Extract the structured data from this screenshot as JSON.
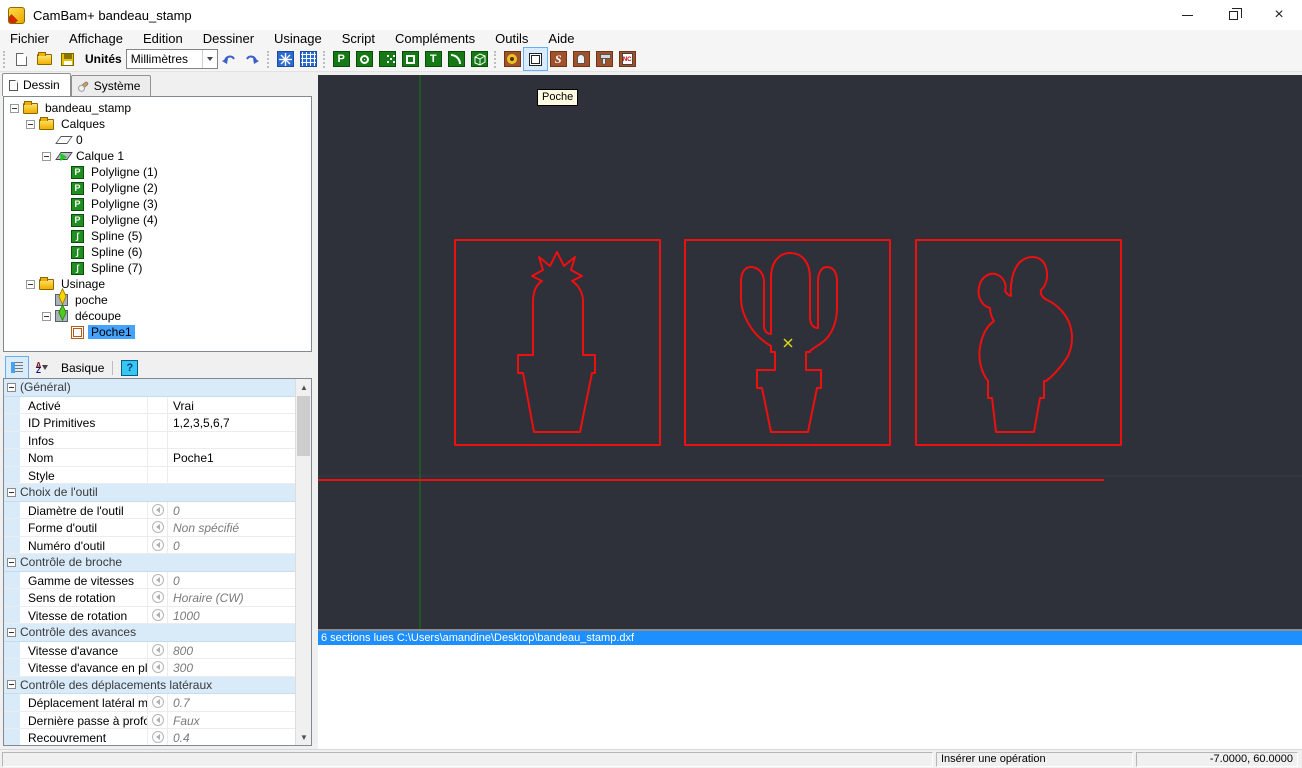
{
  "window": {
    "title": "CamBam+ bandeau_stamp"
  },
  "menu": {
    "items": [
      "Fichier",
      "Affichage",
      "Edition",
      "Dessiner",
      "Usinage",
      "Script",
      "Compléments",
      "Outils",
      "Aide"
    ]
  },
  "toolbar": {
    "units_label": "Unités",
    "units_value": "Millimètres",
    "icons": [
      "new-file",
      "open-file",
      "save",
      "undo",
      "redo",
      "snap-axis",
      "grid",
      "draw-polyline",
      "draw-circle",
      "draw-points",
      "draw-rectangle",
      "draw-text",
      "draw-arc",
      "draw-surface",
      "mach-contour",
      "mach-pocket",
      "mach-engrave",
      "mach-drill",
      "mach-profile3d",
      "mach-gcode"
    ],
    "highlighted_icon": "mach-pocket"
  },
  "tabs": {
    "drawing": "Dessin",
    "system": "Système"
  },
  "tree": {
    "items": [
      {
        "label": "bandeau_stamp",
        "icon": "folder",
        "level": 0,
        "exp": true
      },
      {
        "label": "Calques",
        "icon": "folder",
        "level": 1,
        "exp": true
      },
      {
        "label": "0",
        "icon": "layer",
        "level": 2,
        "exp": false
      },
      {
        "label": "Calque 1",
        "icon": "layer-active",
        "level": 2,
        "exp": true
      },
      {
        "label": "Polyligne (1)",
        "icon": "polyline",
        "level": 3,
        "exp": false
      },
      {
        "label": "Polyligne (2)",
        "icon": "polyline",
        "level": 3,
        "exp": false
      },
      {
        "label": "Polyligne (3)",
        "icon": "polyline",
        "level": 3,
        "exp": false
      },
      {
        "label": "Polyligne (4)",
        "icon": "polyline",
        "level": 3,
        "exp": false
      },
      {
        "label": "Spline (5)",
        "icon": "spline",
        "level": 3,
        "exp": false
      },
      {
        "label": "Spline (6)",
        "icon": "spline",
        "level": 3,
        "exp": false
      },
      {
        "label": "Spline (7)",
        "icon": "spline",
        "level": 3,
        "exp": false
      },
      {
        "label": "Usinage",
        "icon": "folder",
        "level": 1,
        "exp": true
      },
      {
        "label": "poche",
        "icon": "mach-yellow",
        "level": 2,
        "exp": false
      },
      {
        "label": "découpe",
        "icon": "mach-green",
        "level": 2,
        "exp": true
      },
      {
        "label": "Poche1",
        "icon": "pocket-op",
        "level": 3,
        "exp": false,
        "selected": true
      }
    ]
  },
  "properties": {
    "view_label": "Basique",
    "help_label": "?",
    "rows": [
      {
        "type": "cat",
        "label": "(Général)"
      },
      {
        "type": "row",
        "name": "Activé",
        "value": "Vrai",
        "def": false,
        "icon": false
      },
      {
        "type": "row",
        "name": "ID Primitives",
        "value": "1,2,3,5,6,7",
        "def": false,
        "icon": false
      },
      {
        "type": "row",
        "name": "Infos",
        "value": "",
        "def": false,
        "icon": false
      },
      {
        "type": "row",
        "name": "Nom",
        "value": "Poche1",
        "def": false,
        "icon": false
      },
      {
        "type": "row",
        "name": "Style",
        "value": "",
        "def": false,
        "icon": false
      },
      {
        "type": "cat",
        "label": "Choix de l'outil"
      },
      {
        "type": "row",
        "name": "Diamètre de l'outil",
        "value": "0",
        "def": true,
        "icon": true
      },
      {
        "type": "row",
        "name": "Forme d'outil",
        "value": "Non spécifié",
        "def": true,
        "icon": true
      },
      {
        "type": "row",
        "name": "Numéro d'outil",
        "value": "0",
        "def": true,
        "icon": true
      },
      {
        "type": "cat",
        "label": "Contrôle de broche"
      },
      {
        "type": "row",
        "name": "Gamme de vitesses",
        "value": "0",
        "def": true,
        "icon": true
      },
      {
        "type": "row",
        "name": "Sens de rotation",
        "value": "Horaire (CW)",
        "def": true,
        "icon": true
      },
      {
        "type": "row",
        "name": "Vitesse de rotation",
        "value": "1000",
        "def": true,
        "icon": true
      },
      {
        "type": "cat",
        "label": "Contrôle des avances"
      },
      {
        "type": "row",
        "name": "Vitesse d'avance",
        "value": "800",
        "def": true,
        "icon": true
      },
      {
        "type": "row",
        "name": "Vitesse d'avance en plong",
        "value": "300",
        "def": true,
        "icon": true
      },
      {
        "type": "cat",
        "label": "Contrôle des déplacements latéraux"
      },
      {
        "type": "row",
        "name": "Déplacement latéral maxi",
        "value": "0.7",
        "def": true,
        "icon": true
      },
      {
        "type": "row",
        "name": "Dernière passe à profonde",
        "value": "Faux",
        "def": true,
        "icon": true
      },
      {
        "type": "row",
        "name": "Recouvrement",
        "value": "0.4",
        "def": true,
        "icon": true
      }
    ]
  },
  "canvas": {
    "tooltip": "Poche",
    "colors": {
      "background": "#2e303a",
      "outline": "#ee0f0f",
      "axis": "#0e7d0e",
      "marker": "#d6d81a"
    }
  },
  "status": {
    "message": "6 sections lues C:\\Users\\amandine\\Desktop\\bandeau_stamp.dxf",
    "hint": "Insérer une opération",
    "coords": "-7.0000, 60.0000"
  }
}
